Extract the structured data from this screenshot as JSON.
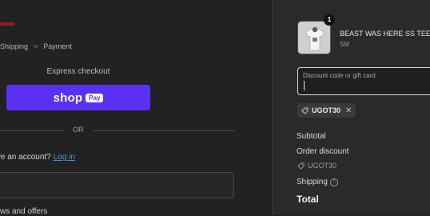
{
  "breadcrumb": {
    "items": [
      "Shipping",
      "Payment"
    ],
    "separator": ">"
  },
  "express": {
    "title": "Express checkout",
    "shop_pay": {
      "word": "shop",
      "badge": "Pay",
      "color": "#5a31f4"
    }
  },
  "divider": {
    "text": "OR"
  },
  "account": {
    "prompt": "Have an account?",
    "login_link": "Log in"
  },
  "newsletter": {
    "text": "ws and offers"
  },
  "cart": {
    "quantity": "1",
    "product_title": "BEAST WAS HERE SS TEE - \\",
    "variant": "SM"
  },
  "discount": {
    "placeholder": "Discount code or gift card",
    "applied_code": "UGOT30"
  },
  "summary": {
    "subtotal_label": "Subtotal",
    "order_discount_label": "Order discount",
    "discount_code": "UGOT30",
    "shipping_label": "Shipping",
    "shipping_help": "?",
    "total_label": "Total"
  },
  "icons": {
    "tag": "tag-icon",
    "remove": "close-icon",
    "help": "question-icon",
    "chevron": "chevron-right-icon"
  }
}
